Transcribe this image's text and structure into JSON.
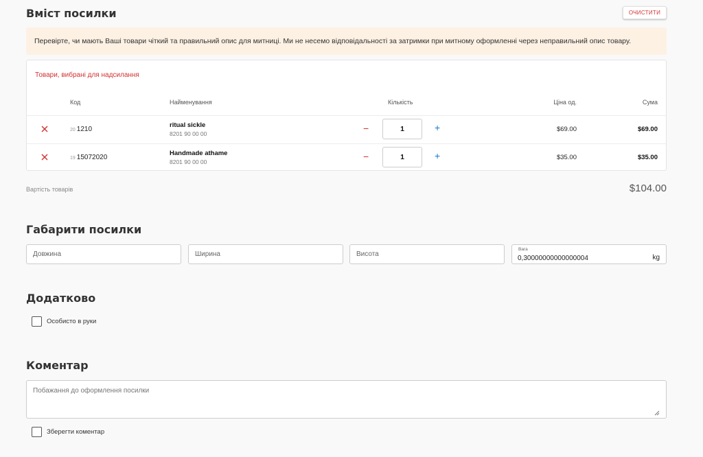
{
  "header": {
    "title": "Вміст посилки",
    "clear_button": "ОЧИСТИТИ"
  },
  "notice": "Перевірте, чи мають Ваші товари чіткий та правильний опис для митниці. Ми не несемо відповідальності за затримки при митному оформленні через неправильний опис товару.",
  "items_table": {
    "title": "Товари, вибрані для надсилання",
    "columns": {
      "code": "Код",
      "name": "Найменування",
      "qty": "Кількість",
      "unit_price": "Ціна од.",
      "sum": "Сума"
    },
    "rows": [
      {
        "num": "20",
        "code": "1210",
        "name": "ritual sickle",
        "hs_code": "8201 90 00 00",
        "qty": "1",
        "unit_price": "$69.00",
        "sum": "$69.00"
      },
      {
        "num": "19",
        "code": "15072020",
        "name": "Handmade athame",
        "hs_code": "8201 90 00 00",
        "qty": "1",
        "unit_price": "$35.00",
        "sum": "$35.00"
      }
    ]
  },
  "total": {
    "label": "Вартість товарів",
    "value": "$104.00"
  },
  "dimensions": {
    "title": "Габарити посилки",
    "length_placeholder": "Довжина",
    "width_placeholder": "Ширина",
    "height_placeholder": "Висота",
    "weight_label": "Вага",
    "weight_value": "0,30000000000000004",
    "weight_unit": "kg"
  },
  "extra": {
    "title": "Додатково",
    "personal_delivery_label": "Особисто в руки"
  },
  "comment": {
    "title": "Коментар",
    "placeholder": "Побажання до оформлення посилки",
    "save_label": "Зберегти коментар"
  },
  "colors": {
    "accent_red": "#d32f2f",
    "accent_blue": "#1976d2",
    "notice_bg": "#fcf1e3"
  }
}
